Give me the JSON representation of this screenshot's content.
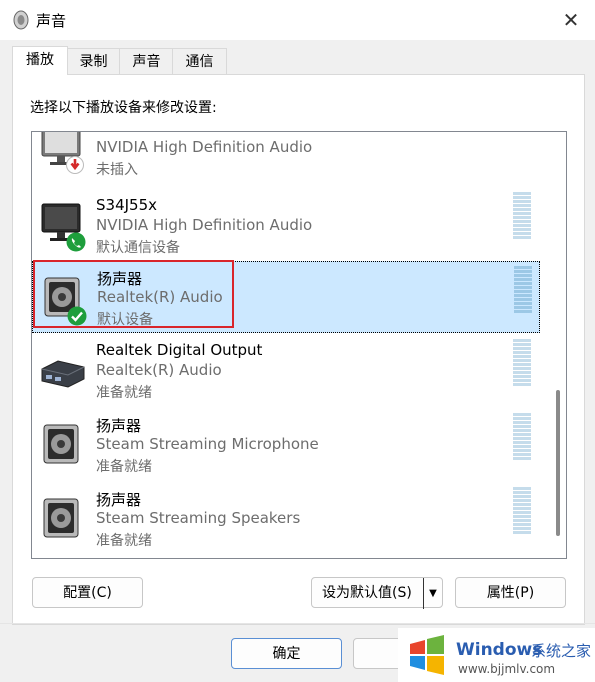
{
  "window": {
    "title": "声音",
    "close_glyph": "✕"
  },
  "tabs": [
    {
      "label": "播放",
      "active": true
    },
    {
      "label": "录制",
      "active": false
    },
    {
      "label": "声音",
      "active": false
    },
    {
      "label": "通信",
      "active": false
    }
  ],
  "prompt": "选择以下播放设备来修改设置:",
  "devices": [
    {
      "name": "",
      "description": "NVIDIA High Definition Audio",
      "status": "未插入",
      "icon": "monitor-icon",
      "badge": "unplugged-arrow-icon",
      "selected": false
    },
    {
      "name": "S34J55x",
      "description": "NVIDIA High Definition Audio",
      "status": "默认通信设备",
      "icon": "monitor-icon",
      "badge": "phone-check-icon",
      "selected": false
    },
    {
      "name": "扬声器",
      "description": "Realtek(R) Audio",
      "status": "默认设备",
      "icon": "speaker-icon",
      "badge": "green-check-icon",
      "selected": true
    },
    {
      "name": "Realtek Digital Output",
      "description": "Realtek(R) Audio",
      "status": "准备就绪",
      "icon": "digital-output-icon",
      "badge": "",
      "selected": false
    },
    {
      "name": "扬声器",
      "description": "Steam Streaming Microphone",
      "status": "准备就绪",
      "icon": "speaker-icon",
      "badge": "",
      "selected": false
    },
    {
      "name": "扬声器",
      "description": "Steam Streaming Speakers",
      "status": "准备就绪",
      "icon": "speaker-icon",
      "badge": "",
      "selected": false
    }
  ],
  "buttons": {
    "configure": "配置(C)",
    "set_default": "设为默认值(S)",
    "properties": "属性(P)",
    "ok": "确定",
    "cancel": ""
  },
  "watermark": {
    "brand": "Windows",
    "brand_cn": "系统之家",
    "url": "www.bjjmlv.com"
  },
  "colors": {
    "selection_bg": "#cce8ff",
    "highlight_border": "#d9252b",
    "status_green": "#1e9e3c",
    "unplugged_red": "#d42a2a"
  }
}
